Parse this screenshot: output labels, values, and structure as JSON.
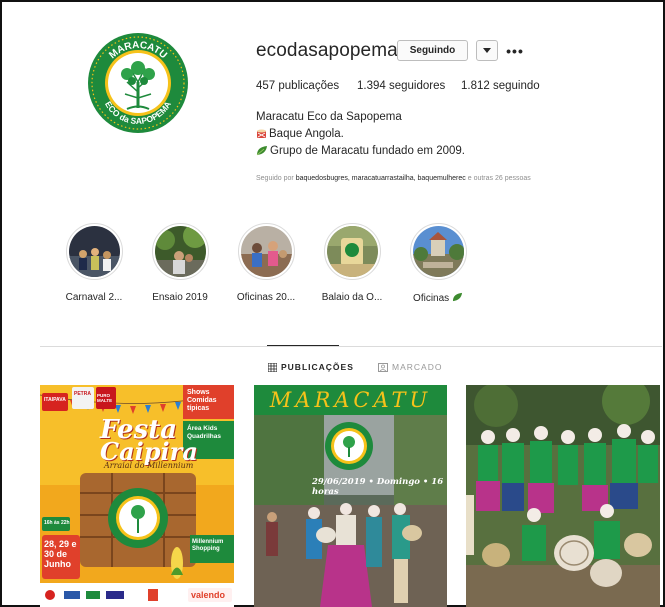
{
  "profile": {
    "username": "ecodasapopema",
    "follow_label": "Seguindo",
    "dropdown_icon": "chevron-down-icon",
    "more_icon": "more-icon",
    "more_label": "•••",
    "logo_top_text": "MARACATU",
    "logo_bottom_text": "ECO da SAPOPEMA",
    "stats": {
      "posts": "457 publicações",
      "followers": "1.394 seguidores",
      "following": "1.812 seguindo"
    },
    "bio": {
      "name": "Maracatu Eco da Sapopema",
      "line1": "Baque Angola.",
      "line2": "Grupo de Maracatu fundado em 2009."
    },
    "followed_by": {
      "prefix": "Seguido por",
      "users": "baquedosbugres, maracatuarrastailha, baquemulherec",
      "suffix": "e outras 26 pessoas"
    }
  },
  "highlights": [
    {
      "label": "Carnaval 2..."
    },
    {
      "label": "Ensaio 2019"
    },
    {
      "label": "Oficinas 20..."
    },
    {
      "label": "Balaio da O..."
    },
    {
      "label": "Oficinas"
    }
  ],
  "tabs": [
    {
      "label": "PUBLICAÇÕES",
      "icon": "grid-icon",
      "active": true
    },
    {
      "label": "MARCADO",
      "icon": "tag-icon",
      "active": false
    }
  ],
  "posts": [
    {
      "brand_left": "ITAIPAVA",
      "brand_mid": "PETRA",
      "brand_mid2": "PURO MALTE",
      "title_1": "Festa",
      "title_2": "Caipira",
      "subtitle": "Arraial do Millennium",
      "shows": "Shows",
      "comidas": "Comidas típicas",
      "kids": "Área Kids Quadrilhas",
      "date_label": "28, 29 e 30 de Junho",
      "time_label": "16h às 22h",
      "venue": "Millennium Shopping",
      "sponsor": "valendo"
    },
    {
      "header": "MARACATU",
      "date_line": "29/06/2019 • Domingo • 16 horas"
    },
    {}
  ],
  "colors": {
    "green": "#1e8a3c",
    "yellow": "#f6c21a",
    "orange": "#e0402b",
    "border": "#dbdbdb",
    "muted": "#8e8e8e"
  }
}
